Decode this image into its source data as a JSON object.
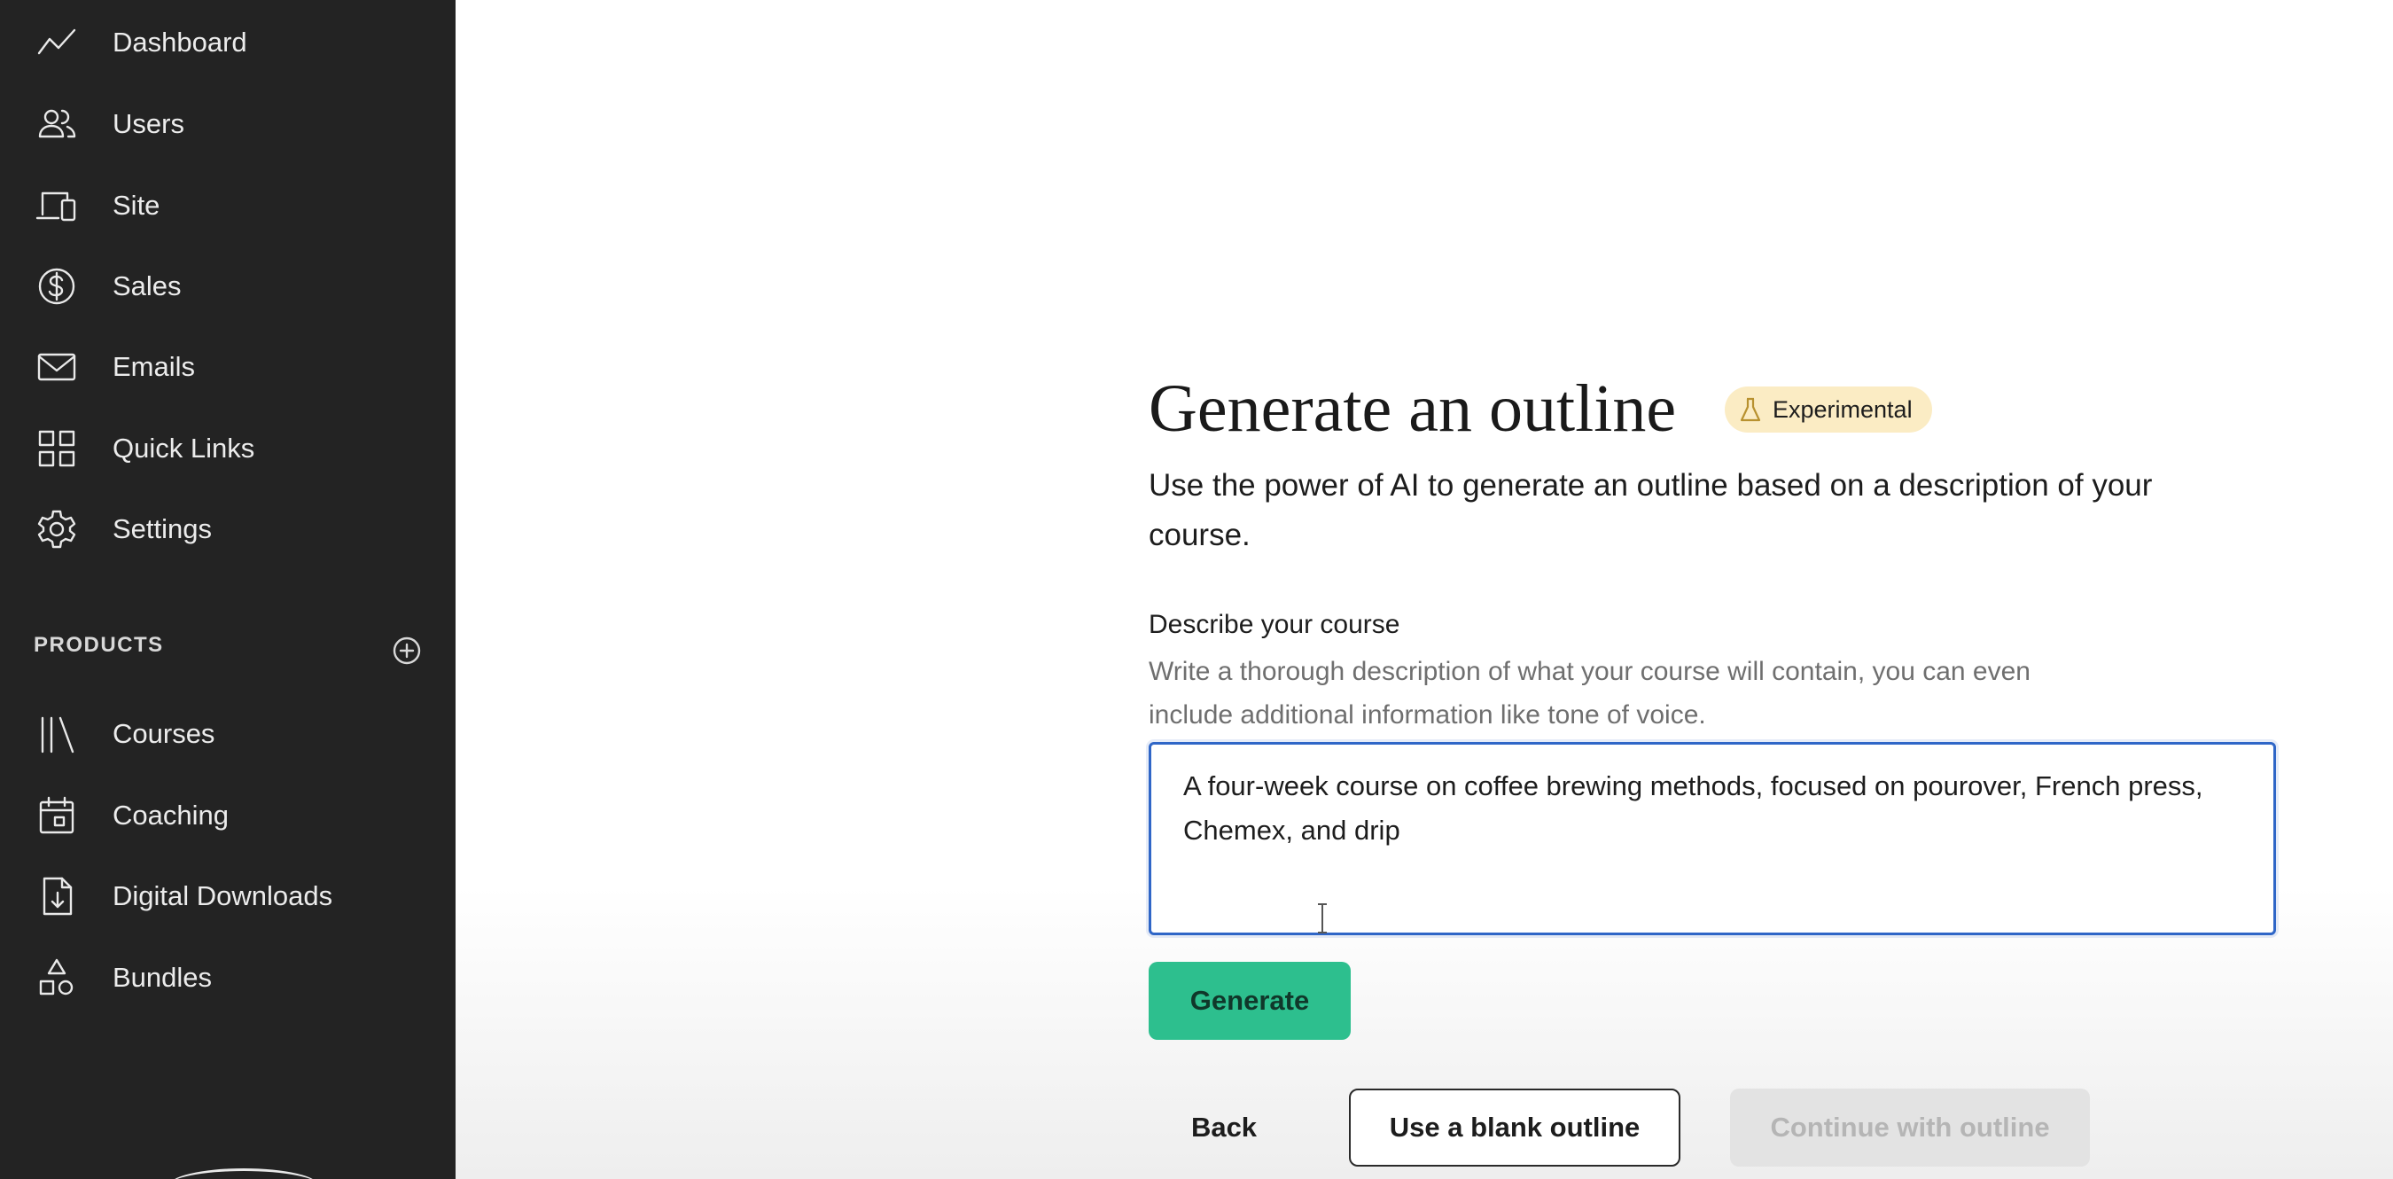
{
  "sidebar": {
    "nav_items": [
      {
        "label": "Dashboard",
        "icon": "trend-line-icon"
      },
      {
        "label": "Users",
        "icon": "users-icon"
      },
      {
        "label": "Site",
        "icon": "devices-icon"
      },
      {
        "label": "Sales",
        "icon": "dollar-circle-icon"
      },
      {
        "label": "Emails",
        "icon": "envelope-icon"
      },
      {
        "label": "Quick Links",
        "icon": "grid-icon"
      },
      {
        "label": "Settings",
        "icon": "gear-icon"
      }
    ],
    "products_header": "PRODUCTS",
    "product_items": [
      {
        "label": "Courses",
        "icon": "books-icon"
      },
      {
        "label": "Coaching",
        "icon": "calendar-icon"
      },
      {
        "label": "Digital Downloads",
        "icon": "download-file-icon"
      },
      {
        "label": "Bundles",
        "icon": "shapes-icon"
      }
    ]
  },
  "main": {
    "title": "Generate an outline",
    "badge": "Experimental",
    "subtitle": "Use the power of AI to generate an outline based on a description of your course.",
    "field_label": "Describe your course",
    "field_help": "Write a thorough description of what your course will contain, you can even include additional information like tone of voice.",
    "description_value": "A four-week course on coffee brewing methods, focused on pourover, French press, Chemex, and drip",
    "generate_label": "Generate",
    "back_label": "Back",
    "blank_outline_label": "Use a blank outline",
    "continue_label": "Continue with outline"
  },
  "colors": {
    "sidebar_bg": "#232323",
    "accent_green": "#2dbf8e",
    "badge_bg": "#fbecc4",
    "focus_blue": "#2f66c7"
  }
}
